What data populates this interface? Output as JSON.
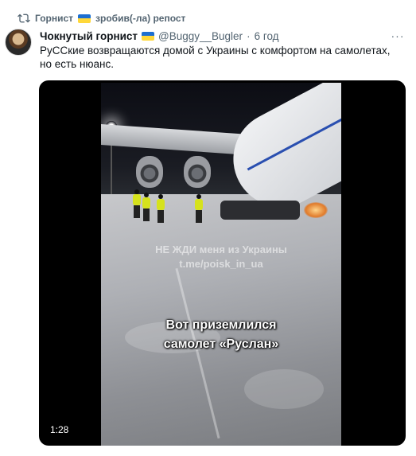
{
  "repost": {
    "user_name": "Горнист",
    "action": "зробив(-ла) репост"
  },
  "tweet": {
    "display_name": "Чокнутый горнист",
    "handle": "@Buggy__Bugler",
    "separator": "·",
    "time": "6 год",
    "more_label": "···",
    "text": "РуССкие возвращаются домой с Украины с комфортом на самолетах, но есть нюанс."
  },
  "video": {
    "watermark_line1": "НЕ ЖДИ меня из Украины",
    "watermark_line2": "t.me/poisk_in_ua",
    "caption_line1": "Вот приземлился",
    "caption_line2": "самолет «Руслан»",
    "duration": "1:28"
  },
  "colors": {
    "secondary_text": "#536471",
    "flag_blue": "#1d6fd1",
    "flag_yellow": "#ffd83a"
  },
  "icons": {
    "repost": "repost-icon",
    "more": "more-icon",
    "flag": "ukraine-flag-icon"
  }
}
